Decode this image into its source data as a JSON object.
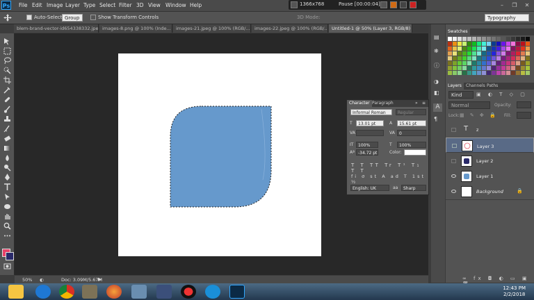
{
  "app": {
    "logo": "Ps"
  },
  "menu": [
    "File",
    "Edit",
    "Image",
    "Layer",
    "Type",
    "Select",
    "Filter",
    "3D",
    "View",
    "Window",
    "Help"
  ],
  "recorder": {
    "resolution": "1366x768",
    "status": "Pause [00:00:04]"
  },
  "options": {
    "auto_select_label": "Auto-Select:",
    "auto_select_value": "Group",
    "show_transform_label": "Show Transform Controls",
    "mode_3d_label": "3D Mode:",
    "workspace": "Typography"
  },
  "tabs": [
    "blem-brand-vector-id654338332.jpeg",
    "images-8.png @ 100% (Inde...",
    "images-21.jpeg @ 100% (RGB/...",
    "images-22.jpeg @ 100% (RGB/...",
    "Untitled-1 @ 50% (Layer 3, RGB/8) *"
  ],
  "status": {
    "zoom": "50%",
    "doc": "Doc: 3.09M/5.67M"
  },
  "swatches": {
    "title": "Swatches"
  },
  "layers_panel": {
    "tabs": [
      "Layers",
      "Channels",
      "Paths"
    ],
    "kind": "Kind",
    "blend": "Normal",
    "opacity_label": "Opacity:",
    "lock_label": "Lock:",
    "fill_label": "Fill:",
    "layers": [
      {
        "name": "z",
        "type": "text"
      },
      {
        "name": "Layer 3",
        "selected": true
      },
      {
        "name": "Layer 2"
      },
      {
        "name": "Layer 1"
      },
      {
        "name": "Background",
        "italic": true
      }
    ]
  },
  "character": {
    "tabs": [
      "Character",
      "Paragraph"
    ],
    "font": "Informal Roman",
    "style": "Regular",
    "size": "13.01 pt",
    "leading": "15.61 pt",
    "tracking": "0",
    "vscale": "100%",
    "hscale": "100%",
    "baseline": "-34.72 pt",
    "color_label": "Color:",
    "language": "English: UK",
    "antialias_icon": "aa",
    "antialias": "Sharp"
  },
  "taskbar": {
    "time": "12:43 PM",
    "date": "2/2/2018"
  },
  "colors": {
    "shape": "#6699cc",
    "selection": "#536a87",
    "fg": "#e8416a",
    "bg": "#2a2a6a"
  }
}
